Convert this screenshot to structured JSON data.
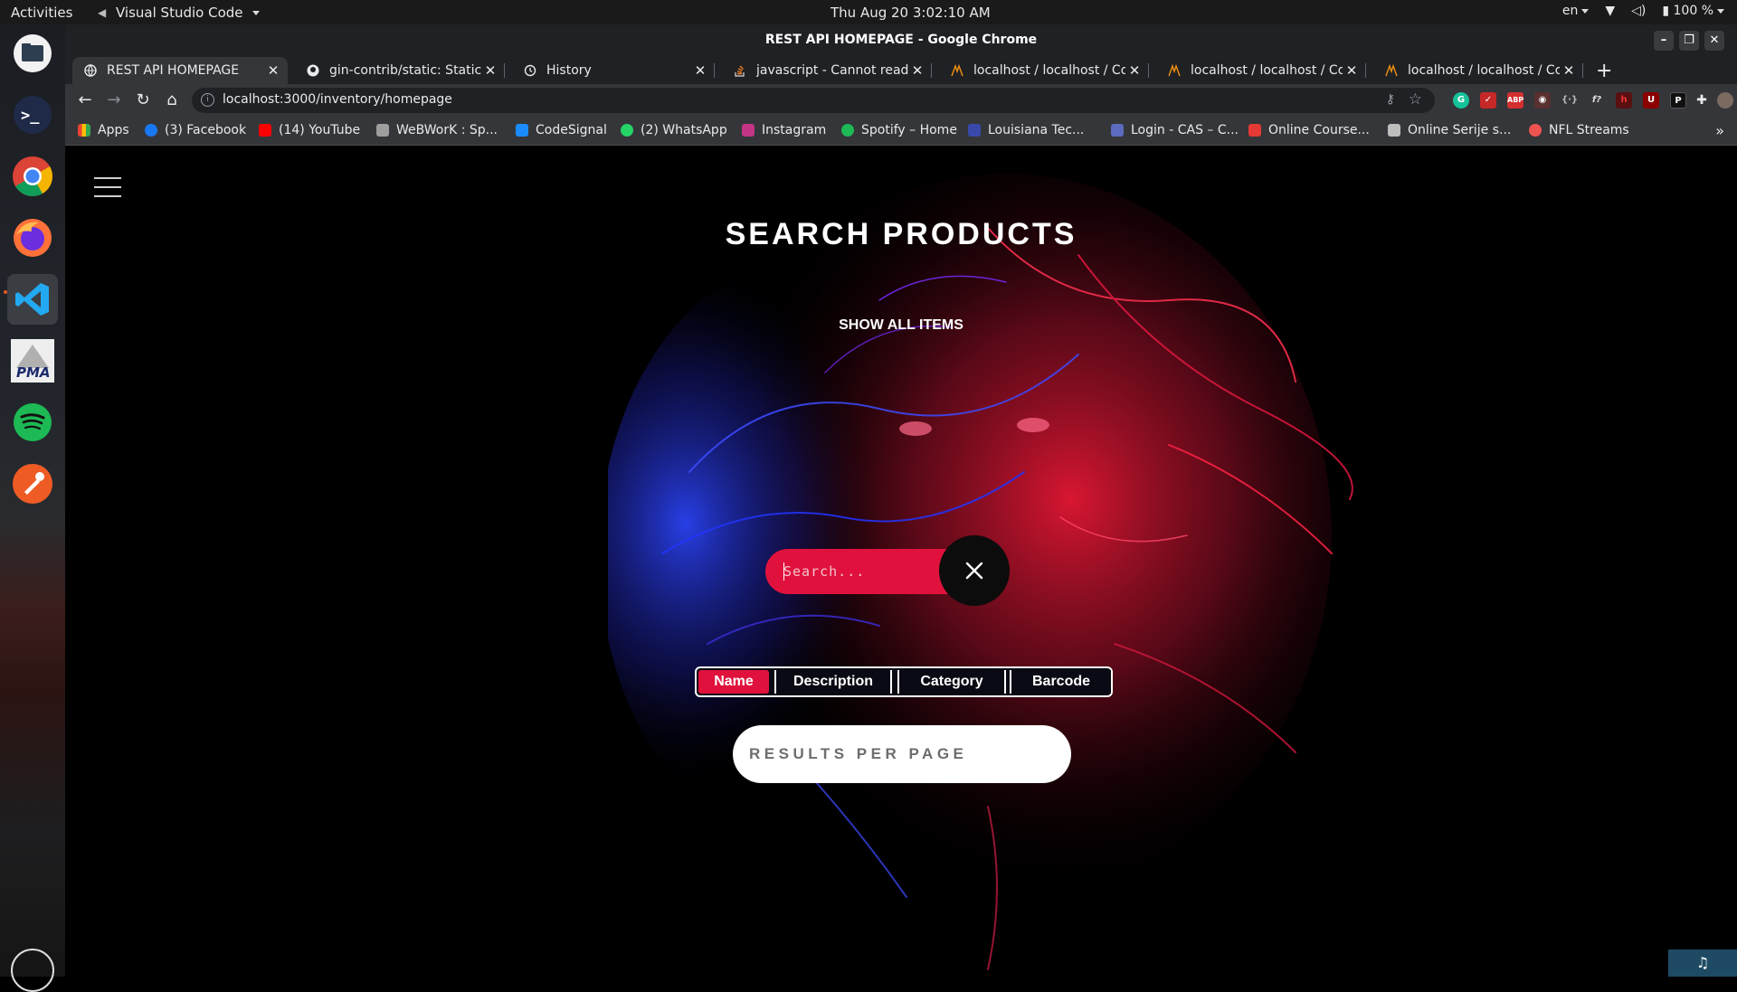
{
  "system": {
    "activities": "Activities",
    "app_name": "Visual Studio Code",
    "clock": "Thu Aug 20   3:02:10 AM",
    "lang": "en",
    "battery": "100 %"
  },
  "dock": {
    "items": [
      "files-icon",
      "terminal-icon",
      "chrome-icon",
      "firefox-icon",
      "vscode-icon",
      "phpmyadmin-icon",
      "spotify-icon",
      "postman-icon"
    ],
    "pma_label": "PMA"
  },
  "window": {
    "title": "REST API HOMEPAGE - Google Chrome"
  },
  "tabs": [
    {
      "label": "REST API HOMEPAGE",
      "icon": "globe-icon"
    },
    {
      "label": "gin-contrib/static: Static f",
      "icon": "github-icon"
    },
    {
      "label": "History",
      "icon": "history-icon"
    },
    {
      "label": "javascript - Cannot read p",
      "icon": "stackoverflow-icon"
    },
    {
      "label": "localhost / localhost / Con",
      "icon": "phpmyadmin-icon"
    },
    {
      "label": "localhost / localhost / Con",
      "icon": "phpmyadmin-icon"
    },
    {
      "label": "localhost / localhost / Con",
      "icon": "phpmyadmin-icon"
    }
  ],
  "toolbar": {
    "url": "localhost:3000/inventory/homepage",
    "ext_abp": "ABP",
    "ext_p": "P"
  },
  "bookmarks": [
    {
      "label": "Apps",
      "color": "#ea4335"
    },
    {
      "label": "(3) Facebook",
      "color": "#1877f2"
    },
    {
      "label": "(14) YouTube",
      "color": "#ff0000"
    },
    {
      "label": "WeBWorK : Sp...",
      "color": "#9e9e9e"
    },
    {
      "label": "CodeSignal",
      "color": "#1a8cff"
    },
    {
      "label": "(2) WhatsApp",
      "color": "#25d366"
    },
    {
      "label": "Instagram",
      "color": "#c13584"
    },
    {
      "label": "Spotify – Home",
      "color": "#1db954"
    },
    {
      "label": "Louisiana Tec...",
      "color": "#3949ab"
    },
    {
      "label": "Login - CAS – C...",
      "color": "#5c6bc0"
    },
    {
      "label": "Online Course...",
      "color": "#e53935"
    },
    {
      "label": "Online Serije s...",
      "color": "#bdbdbd"
    },
    {
      "label": "NFL Streams",
      "color": "#ef5350"
    }
  ],
  "page": {
    "heading": "SEARCH PRODUCTS",
    "show_all": "SHOW ALL ITEMS",
    "search_placeholder": "Search...",
    "filters": [
      "Name",
      "Description",
      "Category",
      "Barcode"
    ],
    "selected_filter": "Name",
    "results_per_page_placeholder": "RESULTS PER PAGE",
    "accent_color": "#e0123d"
  }
}
